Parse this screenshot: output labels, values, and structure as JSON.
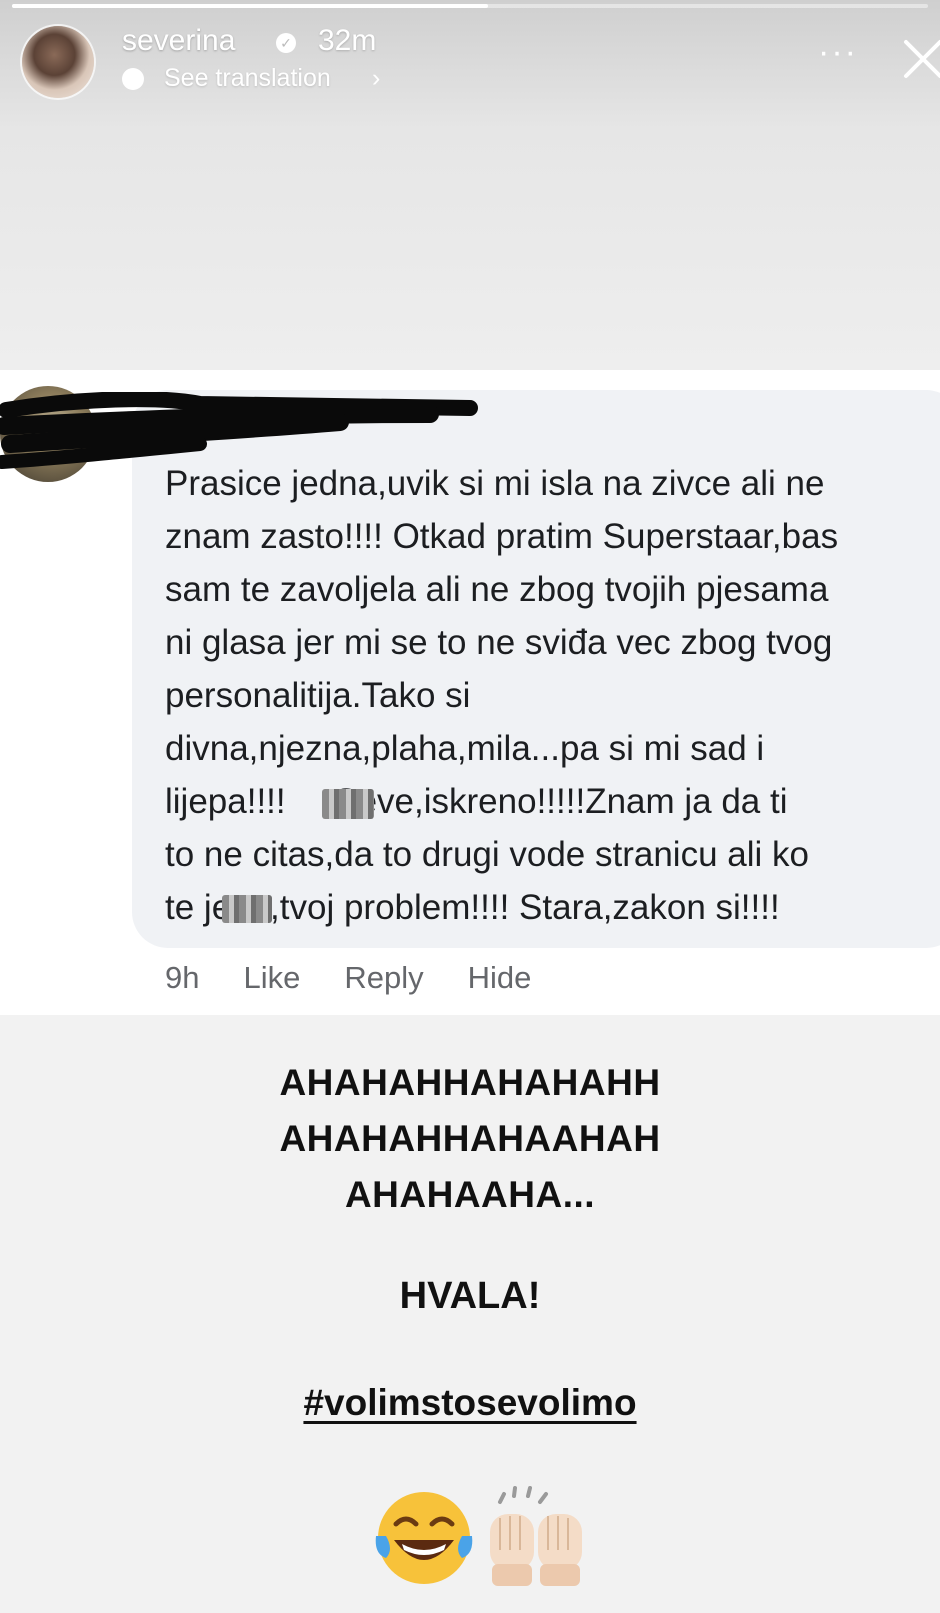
{
  "story": {
    "progress": 0.52,
    "username": "severina",
    "time": "32m",
    "see_translation": "See translation",
    "more_icon": "more-icon",
    "close_icon": "close-icon"
  },
  "comment": {
    "lines": [
      "Prasice jedna,uvik si mi isla na zivce ali ne",
      "znam zasto!!!! Otkad pratim Superstaar,bas",
      "sam te zavoljela ali ne zbog tvojih pjesama",
      "ni glasa jer mi se to ne sviđa vec zbog tvog",
      "personalitija.Tako si",
      "divna,njezna,plaha,mila...pa si mi sad i",
      "lijepa!!!!     Seve,iskreno!!!!!Znam ja da ti",
      "to ne citas,da to drugi vode stranicu ali ko",
      "te je    ,tvoj problem!!!! Stara,zakon si!!!!"
    ],
    "age": "9h",
    "like_label": "Like",
    "reply_label": "Reply",
    "hide_label": "Hide"
  },
  "caption": {
    "lines": [
      "AHAHAHHAHAHAHH",
      "AHAHAHHAHAAHAH",
      "AHAHAAHA..."
    ],
    "thanks": "HVALA!",
    "hashtag": "#volimstosevolimo",
    "emojis": [
      "tears-of-joy-emoji",
      "raising-hands-emoji"
    ]
  },
  "colors": {
    "bubble": "#f0f2f5",
    "comment_text": "#1c1e21",
    "action_text": "#65676b",
    "caption_text": "#111111"
  }
}
